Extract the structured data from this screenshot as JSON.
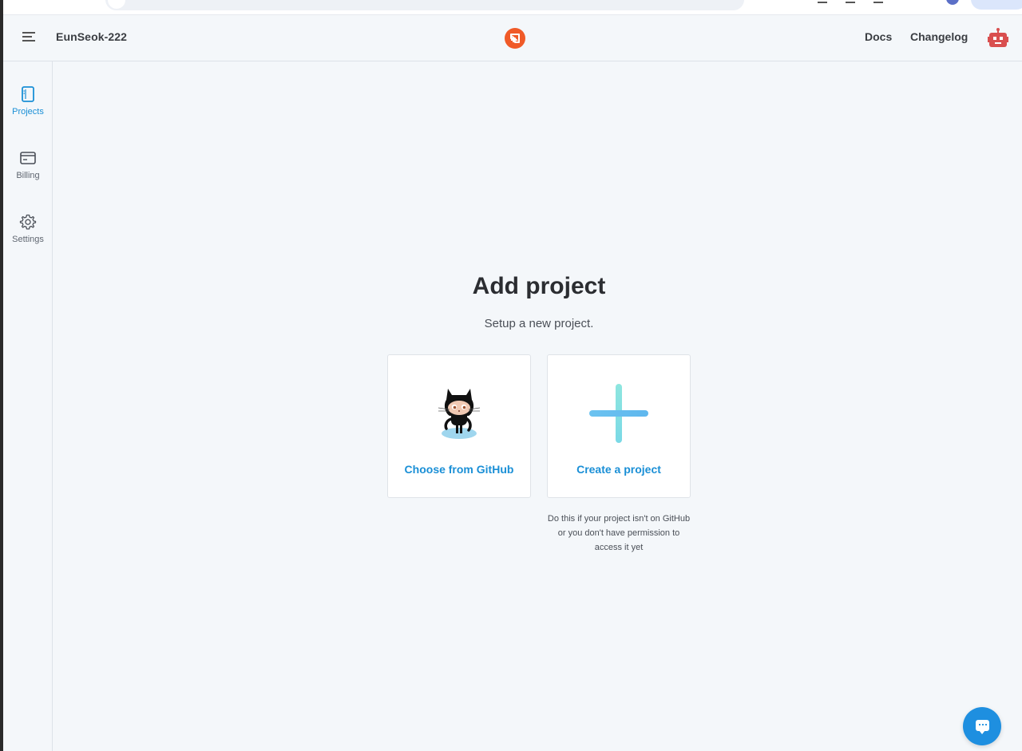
{
  "header": {
    "org_name": "EunSeok-222",
    "nav": {
      "docs": "Docs",
      "changelog": "Changelog"
    }
  },
  "sidebar": {
    "items": [
      {
        "label": "Projects",
        "icon": "book-icon",
        "active": true
      },
      {
        "label": "Billing",
        "icon": "credit-card-icon",
        "active": false
      },
      {
        "label": "Settings",
        "icon": "gear-icon",
        "active": false
      }
    ]
  },
  "main": {
    "title": "Add project",
    "subtitle": "Setup a new project.",
    "options": [
      {
        "label": "Choose from GitHub",
        "icon": "github-octocat-icon"
      },
      {
        "label": "Create a project",
        "icon": "plus-icon"
      }
    ],
    "create_hint": "Do this if your project isn't on GitHub or you don't have permission to access it yet"
  },
  "colors": {
    "accent": "#1a8fd6",
    "brand": "#f05a28",
    "background": "#f4f7fa",
    "chat_button": "#1e8fe0"
  }
}
